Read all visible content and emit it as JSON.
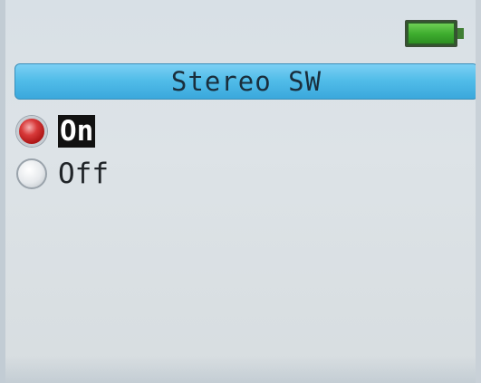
{
  "status": {
    "battery_level": 1.0,
    "battery_color": "#3fae2f"
  },
  "header": {
    "title": "Stereo SW",
    "accent_color": "#52bde9"
  },
  "options": [
    {
      "label": "On",
      "selected": true
    },
    {
      "label": "Off",
      "selected": false
    }
  ]
}
